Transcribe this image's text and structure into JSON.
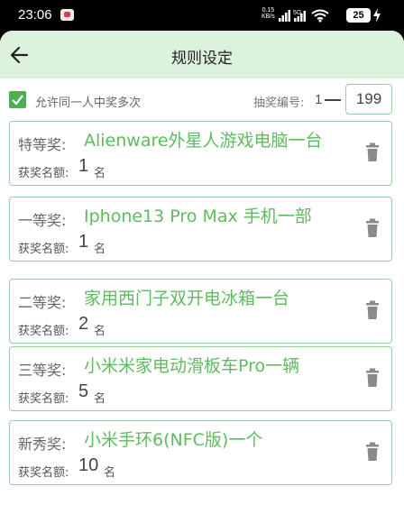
{
  "status": {
    "time": "23:06",
    "speed_value": "0.15",
    "speed_unit": "KB/s",
    "network": "5G",
    "battery": "25"
  },
  "header": {
    "title": "规则设定"
  },
  "options": {
    "allow_multiple_label": "允许同一人中奖多次",
    "allow_multiple_checked": true,
    "number_label": "抽奖编号:",
    "number_start": "1",
    "number_end": "199"
  },
  "prizes": [
    {
      "level": "特等奖:",
      "name": "Alienware外星人游戏电脑一台",
      "count_label": "获奖名额:",
      "count": "1",
      "unit": "名"
    },
    {
      "level": "一等奖:",
      "name": "Iphone13 Pro Max 手机一部",
      "count_label": "获奖名额:",
      "count": "1",
      "unit": "名"
    },
    {
      "level": "二等奖:",
      "name": "家用西门子双开电冰箱一台",
      "count_label": "获奖名额:",
      "count": "2",
      "unit": "名"
    },
    {
      "level": "三等奖:",
      "name": "小米米家电动滑板车Pro一辆",
      "count_label": "获奖名额:",
      "count": "5",
      "unit": "名"
    },
    {
      "level": "新秀奖:",
      "name": "小米手环6(NFC版)一个",
      "count_label": "获奖名额:",
      "count": "10",
      "unit": "名"
    }
  ],
  "icons": {
    "back": "arrow-left-icon",
    "delete": "trash-icon",
    "checkbox": "check-icon"
  },
  "colors": {
    "accent": "#4caf50",
    "prize_text": "#5fbb5f",
    "appbar_bg": "#ddf2dd",
    "card_border": "#9ccf9c"
  }
}
